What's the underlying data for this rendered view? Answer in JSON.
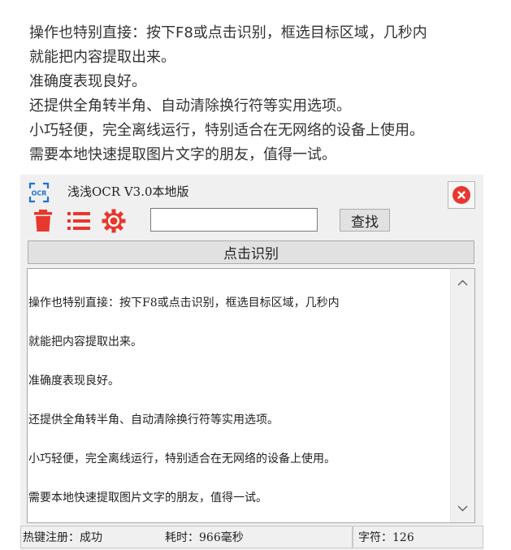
{
  "article": {
    "lines": [
      " 操作也特别直接：按下F8或点击识别，框选目标区域，几秒内",
      "就能把内容提取出来。",
      "准确度表现良好。",
      "还提供全角转半角、自动清除换行符等实用选项。",
      "小巧轻便，完全离线运行，特别适合在无网络的设备上使用。",
      "需要本地快速提取图片文字的朋友，值得一试。"
    ]
  },
  "app": {
    "logo_text": "OCR",
    "title": "浅浅OCR V3.0本地版",
    "search": {
      "value": "",
      "placeholder": ""
    },
    "find_label": "查找",
    "recognize_label": "点击识别",
    "text_lines": [
      "操作也特别直接：按下F8或点击识别，框选目标区域，几秒内",
      "就能把内容提取出来。",
      "准确度表现良好。",
      "还提供全角转半角、自动清除换行符等实用选项。",
      "小巧轻便，完全离线运行，特别适合在无网络的设备上使用。",
      "需要本地快速提取图片文字的朋友，值得一试。"
    ],
    "status": {
      "hotkey": "热键注册：成功",
      "elapsed": "耗时：966毫秒",
      "chars": "字符：126"
    },
    "icons": {
      "logo": "ocr-icon",
      "close": "close-icon",
      "delete": "trash-icon",
      "list": "list-icon",
      "settings": "gear-icon",
      "scroll_up": "chevron-up-icon",
      "scroll_down": "chevron-down-icon"
    },
    "colors": {
      "accent_red": "#e8372d",
      "logo_blue": "#1e6fd9"
    }
  }
}
